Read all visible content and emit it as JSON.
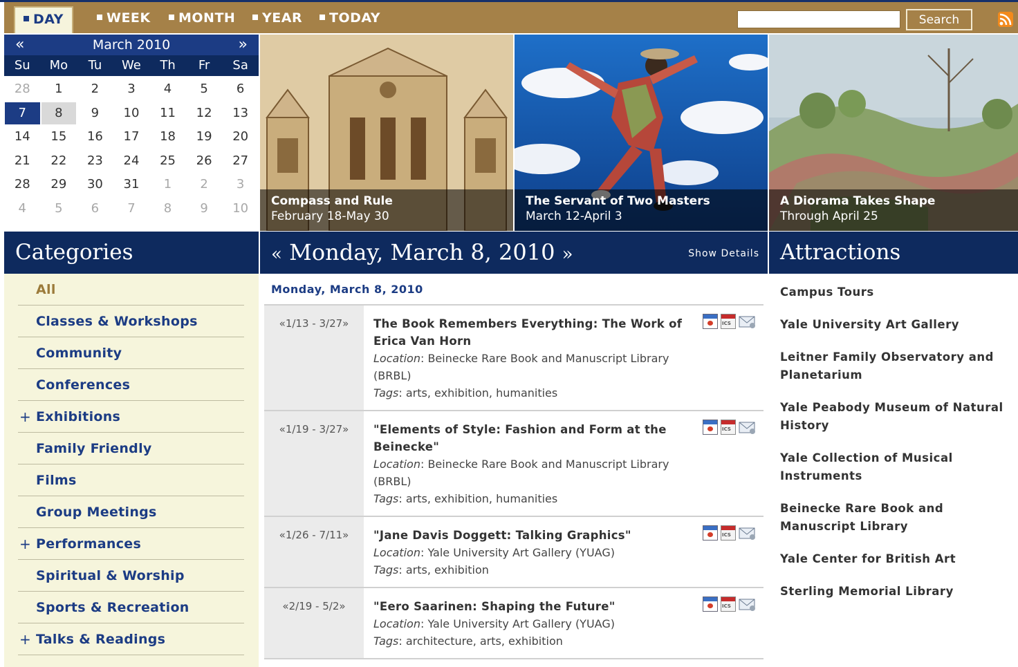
{
  "nav": {
    "tabs": [
      {
        "label": "DAY",
        "active": true
      },
      {
        "label": "WEEK"
      },
      {
        "label": "MONTH"
      },
      {
        "label": "YEAR"
      },
      {
        "label": "TODAY"
      }
    ],
    "search_value": "",
    "search_label": "Search",
    "rss_icon": "rss-icon"
  },
  "mini_calendar": {
    "prev": "«",
    "next": "»",
    "title": "March 2010",
    "weekdays": [
      "Su",
      "Mo",
      "Tu",
      "We",
      "Th",
      "Fr",
      "Sa"
    ],
    "days": [
      {
        "n": "28",
        "other": true
      },
      {
        "n": "1"
      },
      {
        "n": "2"
      },
      {
        "n": "3"
      },
      {
        "n": "4"
      },
      {
        "n": "5"
      },
      {
        "n": "6"
      },
      {
        "n": "7",
        "selected": true
      },
      {
        "n": "8",
        "today": true
      },
      {
        "n": "9"
      },
      {
        "n": "10"
      },
      {
        "n": "11"
      },
      {
        "n": "12"
      },
      {
        "n": "13"
      },
      {
        "n": "14"
      },
      {
        "n": "15"
      },
      {
        "n": "16"
      },
      {
        "n": "17"
      },
      {
        "n": "18"
      },
      {
        "n": "19"
      },
      {
        "n": "20"
      },
      {
        "n": "21"
      },
      {
        "n": "22"
      },
      {
        "n": "23"
      },
      {
        "n": "24"
      },
      {
        "n": "25"
      },
      {
        "n": "26"
      },
      {
        "n": "27"
      },
      {
        "n": "28"
      },
      {
        "n": "29"
      },
      {
        "n": "30"
      },
      {
        "n": "31"
      },
      {
        "n": "1",
        "other": true
      },
      {
        "n": "2",
        "other": true
      },
      {
        "n": "3",
        "other": true
      },
      {
        "n": "4",
        "other": true
      },
      {
        "n": "5",
        "other": true
      },
      {
        "n": "6",
        "other": true
      },
      {
        "n": "7",
        "other": true
      },
      {
        "n": "8",
        "other": true
      },
      {
        "n": "9",
        "other": true
      },
      {
        "n": "10",
        "other": true
      }
    ]
  },
  "features": [
    {
      "title": "Compass and Rule",
      "dates": "February 18-May 30"
    },
    {
      "title": "The Servant of Two Masters",
      "dates": "March 12-April 3"
    },
    {
      "title": "A Diorama Takes Shape",
      "dates": "Through April 25"
    }
  ],
  "categories": {
    "heading": "Categories",
    "items": [
      {
        "label": "All",
        "current": true
      },
      {
        "label": "Classes & Workshops"
      },
      {
        "label": "Community"
      },
      {
        "label": "Conferences"
      },
      {
        "label": "Exhibitions",
        "expandable": true
      },
      {
        "label": "Family Friendly"
      },
      {
        "label": "Films"
      },
      {
        "label": "Group Meetings"
      },
      {
        "label": "Performances",
        "expandable": true
      },
      {
        "label": "Spiritual & Worship"
      },
      {
        "label": "Sports & Recreation"
      },
      {
        "label": "Talks & Readings",
        "expandable": true
      }
    ],
    "expand_glyph": "+"
  },
  "day_view": {
    "prev": "«",
    "title": "Monday, March 8, 2010",
    "next": "»",
    "show_details": "Show Details",
    "date_subheading": "Monday, March 8, 2010",
    "location_label": "Location",
    "tags_label": "Tags",
    "ics_label": "ICS",
    "events": [
      {
        "range": "«1/13 - 3/27»",
        "title": "The Book Remembers Everything: The Work of Erica Van Horn",
        "location": "Beinecke Rare Book and Manuscript Library (BRBL)",
        "tags": "arts, exhibition, humanities"
      },
      {
        "range": "«1/19 - 3/27»",
        "title": "\"Elements of Style: Fashion and Form at the Beinecke\"",
        "location": "Beinecke Rare Book and Manuscript Library (BRBL)",
        "tags": "arts, exhibition, humanities"
      },
      {
        "range": "«1/26 - 7/11»",
        "title": "\"Jane Davis Doggett: Talking Graphics\"",
        "location": "Yale University Art Gallery (YUAG)",
        "tags": "arts, exhibition"
      },
      {
        "range": "«2/19 - 5/2»",
        "title": "\"Eero Saarinen: Shaping the Future\"",
        "location": "Yale University Art Gallery (YUAG)",
        "tags": "architecture, arts, exhibition"
      }
    ]
  },
  "attractions": {
    "heading": "Attractions",
    "items": [
      "Campus Tours",
      "Yale University Art Gallery",
      "Leitner Family Observatory and Planetarium",
      "Yale Peabody Museum of Natural History",
      "Yale Collection of Musical Instruments",
      "Beinecke Rare Book and Manuscript Library",
      "Yale Center for British Art",
      "Sterling Memorial Library"
    ]
  },
  "colors": {
    "navy": "#0e2a5e",
    "gold": "#a58148",
    "cream": "#f6f5dc"
  }
}
